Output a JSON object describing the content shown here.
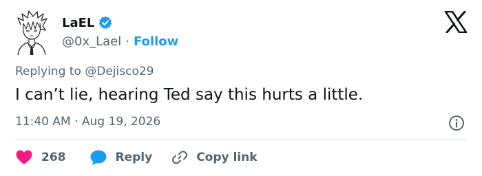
{
  "author": {
    "display_name": "LaEL",
    "handle": "@0x_Lael",
    "separator": "·",
    "follow_label": "Follow",
    "avatar_icon": "anime-boy-sketch-avatar",
    "verified_icon": "verified-badge-icon"
  },
  "brand": {
    "logo_icon": "x-logo-icon"
  },
  "tweet": {
    "replying_prefix": "Replying to",
    "replying_handle": "@Dejisco29",
    "text": "I can’t lie, hearing Ted say this hurts a little.",
    "timestamp": "11:40 AM · Aug 19, 2026"
  },
  "actions": {
    "like_count": "268",
    "reply_label": "Reply",
    "copy_link_label": "Copy link"
  },
  "colors": {
    "accent": "#1d9bf0",
    "like": "#f91880",
    "text": "#0f1419",
    "muted": "#536471",
    "divider": "#cfd9de"
  }
}
